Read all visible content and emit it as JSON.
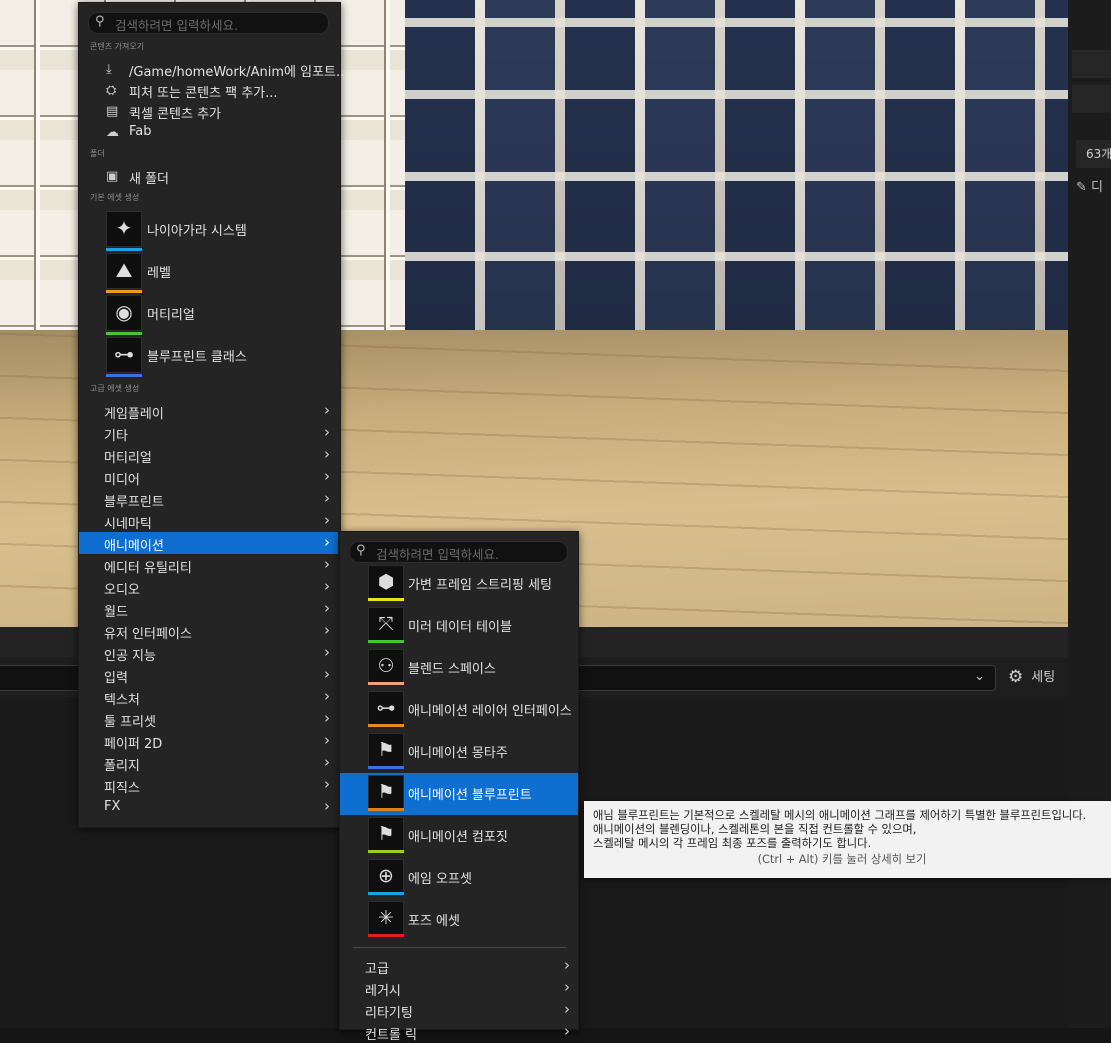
{
  "right_panel": {
    "count": "63개",
    "item_label": "디"
  },
  "bottom": {
    "settings_label": "세팅",
    "dropdown_icon": "chevron-down-icon"
  },
  "menu1": {
    "search_placeholder": "검색하려면 입력하세요.",
    "sections": {
      "import": "콘텐츠 가져오기",
      "folder": "폴더",
      "basic": "기본 에셋 생성",
      "advanced": "고급 에셋 생성"
    },
    "import_items": [
      {
        "icon": "import-icon",
        "label": "/Game/homeWork/Anim에 임포트..."
      },
      {
        "icon": "feature-pack-icon",
        "label": "피처 또는 콘텐츠 팩 추가..."
      },
      {
        "icon": "quixel-icon",
        "label": "퀵셀 콘텐츠 추가"
      },
      {
        "icon": "fab-icon",
        "label": "Fab"
      }
    ],
    "folder_items": [
      {
        "icon": "new-folder-icon",
        "label": "새 폴더"
      }
    ],
    "basic_items": [
      {
        "icon": "niagara-icon",
        "label": "나이아가라 시스템",
        "color": "#1fa0e0"
      },
      {
        "icon": "level-icon",
        "label": "레벨",
        "color": "#f09a1c"
      },
      {
        "icon": "material-icon",
        "label": "머티리얼",
        "color": "#4bc23a"
      },
      {
        "icon": "blueprint-class-icon",
        "label": "블루프린트 클래스",
        "color": "#3a6fe0"
      }
    ],
    "submenus": [
      "게임플레이",
      "기타",
      "머티리얼",
      "미디어",
      "블루프린트",
      "시네마틱",
      "애니메이션",
      "에디터 유틸리티",
      "오디오",
      "월드",
      "유저 인터페이스",
      "인공 지능",
      "입력",
      "텍스처",
      "툴 프리셋",
      "페이퍼 2D",
      "폴리지",
      "피직스",
      "FX"
    ],
    "active_submenu": "애니메이션"
  },
  "menu2": {
    "search_placeholder": "검색하려면 입력하세요.",
    "items": [
      {
        "icon": "variable-frame-strip-icon",
        "label": "가변 프레임 스트리핑 세팅",
        "color": "#e8e020"
      },
      {
        "icon": "mirror-table-icon",
        "label": "미러 데이터 테이블",
        "color": "#4bc23a"
      },
      {
        "icon": "blend-space-icon",
        "label": "블렌드 스페이스",
        "color": "#f0a080"
      },
      {
        "icon": "anim-layer-interface-icon",
        "label": "애니메이션 레이어 인터페이스",
        "color": "#e08a20"
      },
      {
        "icon": "anim-montage-icon",
        "label": "애니메이션 몽타주",
        "color": "#3a6fe0"
      },
      {
        "icon": "anim-blueprint-icon",
        "label": "애니메이션 블루프린트",
        "color": "#e0801c"
      },
      {
        "icon": "anim-composite-icon",
        "label": "애니메이션 컴포짓",
        "color": "#9ad020"
      },
      {
        "icon": "aim-offset-icon",
        "label": "에임 오프셋",
        "color": "#1fa0e0"
      },
      {
        "icon": "pose-asset-icon",
        "label": "포즈 에셋",
        "color": "#e02020"
      }
    ],
    "active_item": "애니메이션 블루프린트",
    "submenus": [
      "고급",
      "레거시",
      "리타기팅",
      "컨트롤 릭"
    ]
  },
  "tooltip": {
    "lines": [
      "애님 블루프린트는 기본적으로 스켈레탈 메시의 애니메이션 그래프를 제어하기 특별한 블루프린트입니다.",
      "애니메이션의 블렌딩이나, 스켈레톤의 본을 직접 컨트롤할 수 있으며,",
      "스켈레탈 메시의 각 프레임 최종 포즈를 출력하기도 합니다."
    ],
    "hint": "(Ctrl + Alt) 키를 눌러 상세히 보기"
  }
}
